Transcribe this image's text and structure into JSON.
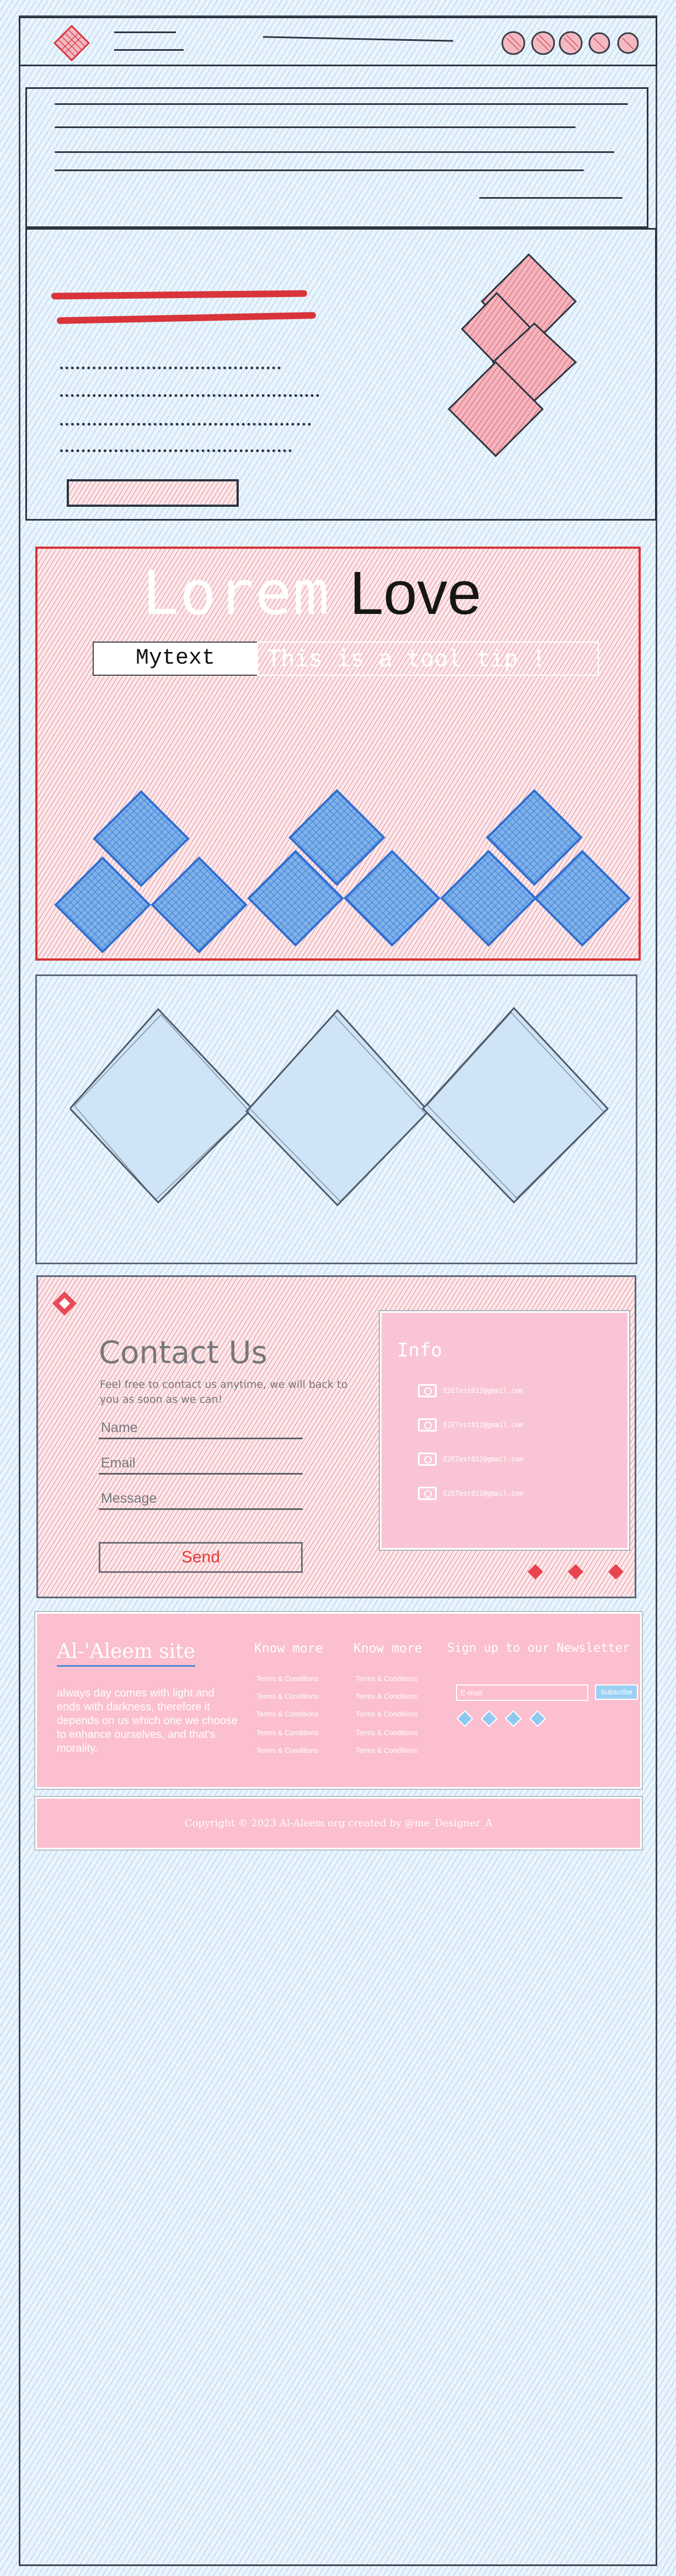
{
  "lorem_section": {
    "title_word_1": "Lorem",
    "title_word_2": "Love",
    "box_text": "Mytext",
    "tagline": "This is a tool tip !"
  },
  "contact": {
    "title": "Contact Us",
    "subtitle": "Feel free to contact us anytime, we will back to you as soon as we can!",
    "name_placeholder": "Name",
    "email_placeholder": "Email",
    "message_placeholder": "Message",
    "send_label": "Send",
    "info": {
      "title": "Info",
      "items": [
        "E2ETest012@gmail.com",
        "E2ETest012@gmail.com",
        "E2ETest012@gmail.com",
        "E2ETest012@gmail.com"
      ]
    }
  },
  "footer": {
    "site_name": "Al-'Aleem site",
    "description": "always day comes with light and ends with darkness, therefore it depends on us which one we choose to enhance ourselves, and that's morality.",
    "columns": [
      {
        "heading": "Know more",
        "links": [
          "Terms & Conditions",
          "Terms & Conditions",
          "Terms & Conditions",
          "Terms & Conditions",
          "Terms & Conditions"
        ]
      },
      {
        "heading": "Know more",
        "links": [
          "Terms & Conditions",
          "Terms & Conditions",
          "Terms & Conditions",
          "Terms & Conditions",
          "Terms & Conditions"
        ]
      }
    ],
    "newsletter": {
      "heading": "Sign up to our Newsletter",
      "placeholder": "E-mail",
      "subscribe_label": "Subscribe"
    },
    "copyright": "Copyright © 2023 Al-Aleem org created by @me_Designer_A"
  },
  "colors": {
    "accent_red": "#d8343a",
    "accent_blue": "#2f6fd0",
    "pink": "#fbbfcf",
    "hatch_blue": "#6eaadc"
  }
}
